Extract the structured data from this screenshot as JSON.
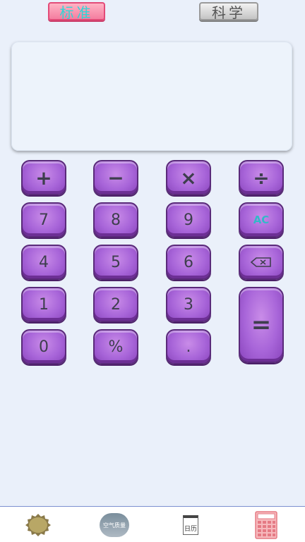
{
  "tabs": {
    "standard": "标准",
    "scientific": "科学"
  },
  "display": {
    "value": ""
  },
  "keys": {
    "plus": "+",
    "minus": "−",
    "multiply": "×",
    "divide": "÷",
    "seven": "7",
    "eight": "8",
    "nine": "9",
    "clear": "AC",
    "four": "4",
    "five": "5",
    "six": "6",
    "one": "1",
    "two": "2",
    "three": "3",
    "equals": "=",
    "zero": "0",
    "percent": "%",
    "dot": "."
  },
  "nav": {
    "air_quality": "空气质量",
    "calendar": "日历"
  },
  "colors": {
    "key_purple": "#a865d9",
    "tab_active": "#f47ea0",
    "tab_text_active": "#2fd6d6",
    "clear_text": "#33b8c8"
  }
}
